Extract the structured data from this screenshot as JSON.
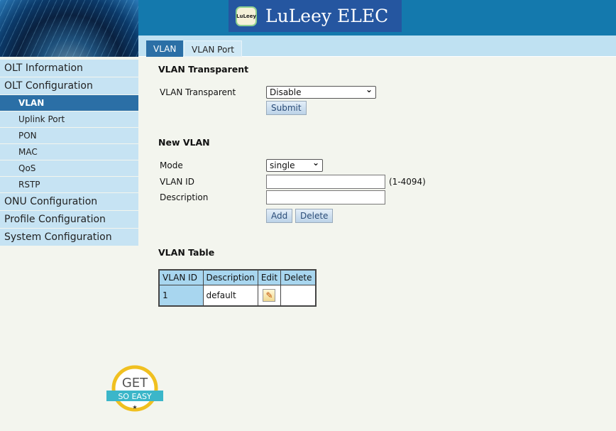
{
  "header": {
    "logo_badge": "LuLeey",
    "logo_text": "LuLeey ELEC"
  },
  "tabs": [
    {
      "label": "VLAN",
      "active": true
    },
    {
      "label": "VLAN Port",
      "active": false
    }
  ],
  "sidebar": {
    "items": [
      {
        "label": "OLT Information"
      },
      {
        "label": "OLT Configuration"
      },
      {
        "label": "VLAN",
        "active": true
      },
      {
        "label": "Uplink Port"
      },
      {
        "label": "PON"
      },
      {
        "label": "MAC"
      },
      {
        "label": "QoS"
      },
      {
        "label": "RSTP"
      },
      {
        "label": "ONU Configuration"
      },
      {
        "label": "Profile Configuration"
      },
      {
        "label": "System Configuration"
      }
    ]
  },
  "transparent": {
    "title": "VLAN Transparent",
    "label": "VLAN Transparent",
    "value": "Disable",
    "submit": "Submit"
  },
  "new_vlan": {
    "title": "New VLAN",
    "mode_label": "Mode",
    "mode_value": "single",
    "id_label": "VLAN ID",
    "id_value": "",
    "id_hint": "(1-4094)",
    "desc_label": "Description",
    "desc_value": "",
    "add": "Add",
    "delete": "Delete"
  },
  "table": {
    "title": "VLAN Table",
    "headers": [
      "VLAN ID",
      "Description",
      "Edit",
      "Delete"
    ],
    "rows": [
      {
        "id": "1",
        "description": "default"
      }
    ]
  },
  "watermark": {
    "line1": "GET",
    "line2": "SO EASY"
  }
}
